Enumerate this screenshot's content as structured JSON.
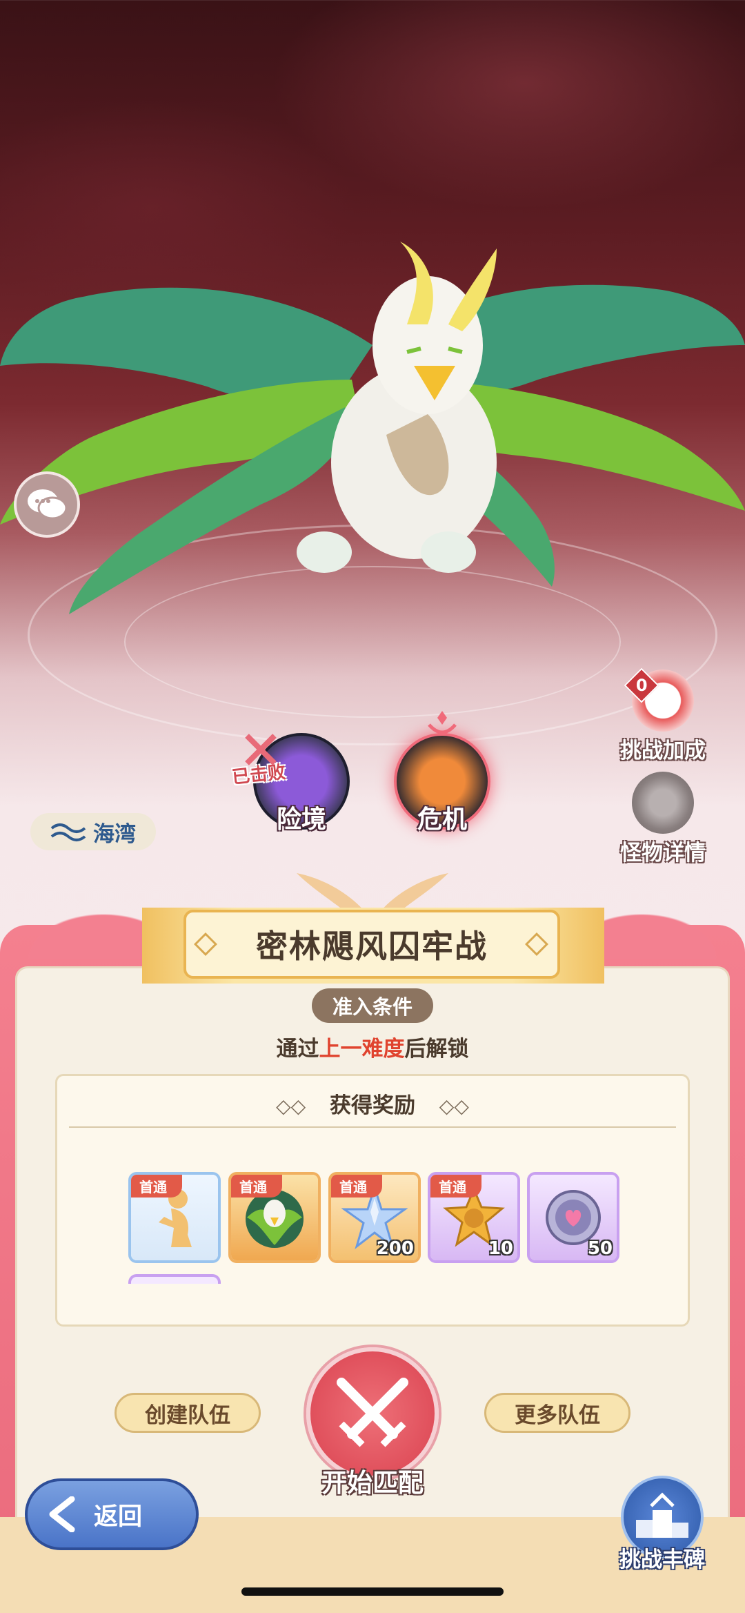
{
  "location": {
    "label": "海湾"
  },
  "side": {
    "challenge_bonus_label": "挑战加成",
    "challenge_bonus_count": "0",
    "monster_detail_label": "怪物详情"
  },
  "difficulties": [
    {
      "label": "险境",
      "status": "已击败"
    },
    {
      "label": "危机"
    }
  ],
  "panel": {
    "title": "密林飓风囚牢战",
    "condition_label": "准入条件",
    "unlock_prefix": "通过",
    "unlock_highlight": "上一难度",
    "unlock_suffix": "后解锁",
    "rewards_title": "获得奖励",
    "rewards": [
      {
        "tag": "首通",
        "count": "",
        "icon": "figure-icon"
      },
      {
        "tag": "首通",
        "count": "",
        "icon": "griffin-portrait-icon"
      },
      {
        "tag": "首通",
        "count": "200",
        "icon": "crystal-star-icon"
      },
      {
        "tag": "首通",
        "count": "10",
        "icon": "gold-star-coin-icon"
      },
      {
        "tag": "",
        "count": "50",
        "icon": "heart-coin-icon"
      }
    ]
  },
  "actions": {
    "create_team": "创建队伍",
    "more_teams": "更多队伍",
    "start_match": "开始匹配",
    "back": "返回",
    "trophy": "挑战丰碑"
  },
  "colors": {
    "accent": "#e0432e",
    "panel_pink": "#ea6a7c",
    "back_blue": "#4a74c8"
  }
}
